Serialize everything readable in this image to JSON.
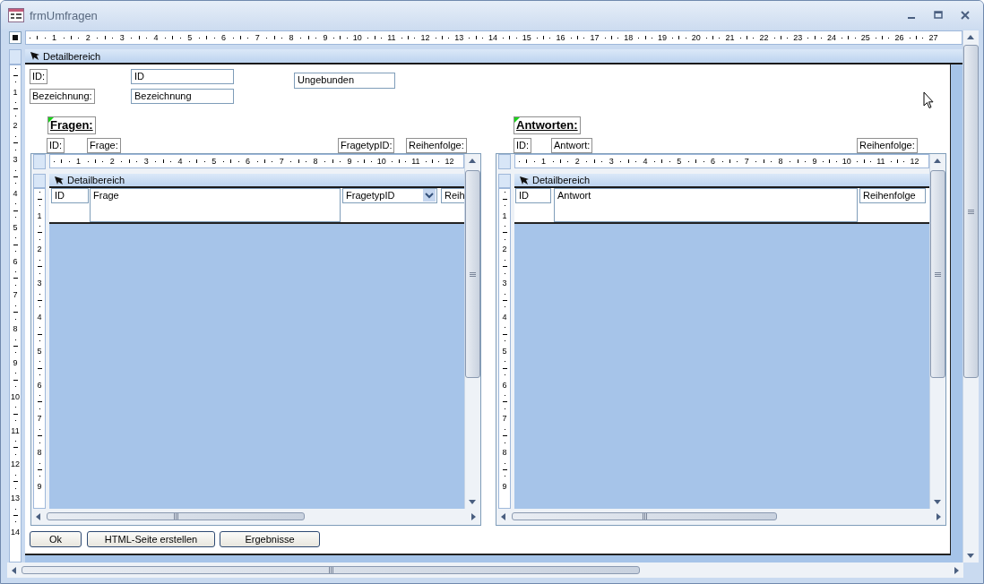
{
  "window": {
    "title": "frmUmfragen"
  },
  "ruler": {
    "horizontal": [
      "1",
      "2",
      "3",
      "4",
      "5",
      "6",
      "7",
      "8",
      "9",
      "10",
      "11",
      "12",
      "13",
      "14",
      "15",
      "16",
      "17",
      "18",
      "19",
      "20",
      "21",
      "22",
      "23",
      "24",
      "25",
      "26",
      "27"
    ],
    "vertical": [
      "1",
      "2",
      "3",
      "4",
      "5",
      "6",
      "7",
      "8",
      "9",
      "10",
      "11",
      "12",
      "13",
      "14"
    ]
  },
  "section": {
    "title": "Detailbereich"
  },
  "fields": [
    {
      "label": "ID:",
      "value": "ID"
    },
    {
      "label": "Bezeichnung:",
      "value": "Bezeichnung"
    }
  ],
  "unbound": {
    "value": "Ungebunden"
  },
  "subforms": [
    {
      "title": "Fragen:",
      "column_labels": [
        "ID:",
        "Frage:",
        "FragetypID:",
        "Reihenfolge:"
      ],
      "ruler": {
        "horizontal": [
          "1",
          "2",
          "3",
          "4",
          "5",
          "6",
          "7",
          "8",
          "9",
          "10",
          "11",
          "12"
        ],
        "vertical": [
          "1",
          "2",
          "3",
          "4",
          "5",
          "6",
          "7",
          "8",
          "9"
        ]
      },
      "section": {
        "title": "Detailbereich"
      },
      "controls": [
        {
          "kind": "text",
          "value": "ID"
        },
        {
          "kind": "memo",
          "value": "Frage"
        },
        {
          "kind": "combo",
          "value": "FragetypID"
        },
        {
          "kind": "text",
          "value": "Reih"
        }
      ]
    },
    {
      "title": "Antworten:",
      "column_labels": [
        "ID:",
        "Antwort:",
        "Reihenfolge:"
      ],
      "ruler": {
        "horizontal": [
          "1",
          "2",
          "3",
          "4",
          "5",
          "6",
          "7",
          "8",
          "9",
          "10",
          "11",
          "12"
        ],
        "vertical": [
          "1",
          "2",
          "3",
          "4",
          "5",
          "6",
          "7",
          "8",
          "9"
        ]
      },
      "section": {
        "title": "Detailbereich"
      },
      "controls": [
        {
          "kind": "text",
          "value": "ID"
        },
        {
          "kind": "memo",
          "value": "Antwort"
        },
        {
          "kind": "text",
          "value": "Reihenfolge"
        }
      ]
    }
  ],
  "buttons": [
    "Ok",
    "HTML-Seite erstellen",
    "Ergebnisse"
  ]
}
